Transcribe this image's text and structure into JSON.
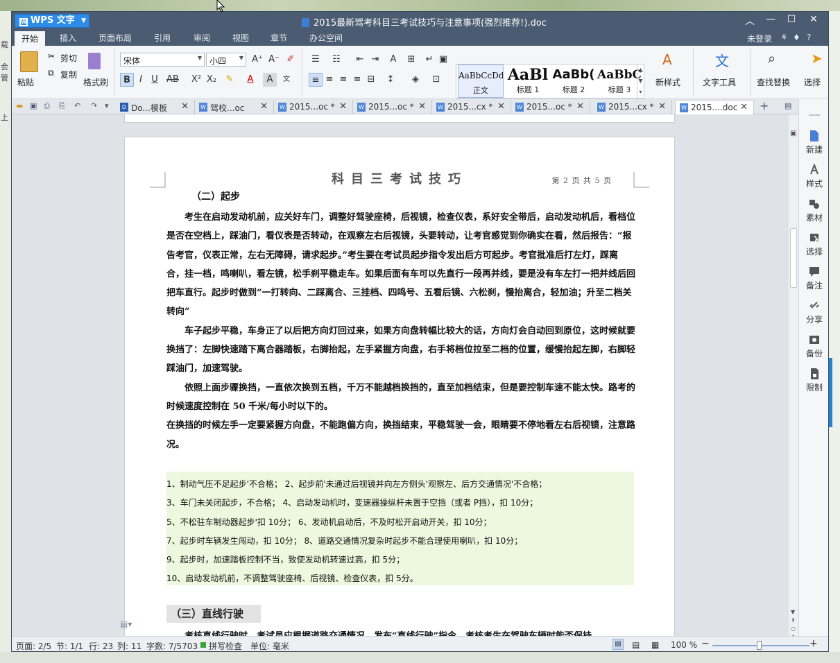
{
  "window": {
    "app_name": "WPS 文字",
    "doc_title": "2015最新驾考科目三考试技巧与注意事项(强烈推荐!).doc",
    "controls": [
      "︿",
      "—",
      "☐",
      "✕"
    ]
  },
  "menu": {
    "tabs": [
      "开始",
      "插入",
      "页面布局",
      "引用",
      "审阅",
      "视图",
      "章节",
      "办公空间"
    ],
    "login": "未登录",
    "help": "?"
  },
  "ribbon": {
    "paste": "粘贴",
    "cut": "剪切",
    "copy": "复制",
    "format_painter": "格式刷",
    "font_name": "宋体",
    "font_size": "小四",
    "styles": [
      {
        "sample": "AaBbCcDd",
        "label": "正文"
      },
      {
        "sample": "AaBl",
        "label": "标题 1"
      },
      {
        "sample": "AaBb(",
        "label": "标题 2"
      },
      {
        "sample": "AaBbC",
        "label": "标题 3"
      }
    ],
    "new_style": "新样式",
    "text_tools": "文字工具",
    "find_replace": "查找替换",
    "select": "选择"
  },
  "tabs": [
    {
      "label": "Do...模板"
    },
    {
      "label": "驾校...oc"
    },
    {
      "label": "2015...oc *"
    },
    {
      "label": "2015...oc *"
    },
    {
      "label": "2015...cx *"
    },
    {
      "label": "2015...oc *"
    },
    {
      "label": "2015...cx *"
    },
    {
      "label": "2015....doc"
    }
  ],
  "page": {
    "header_title": "科目三考试技巧",
    "header_page": "第 2 页 共 5 页",
    "subheading": "（二）起步",
    "paragraphs": [
      "考生在启动发动机前，应关好车门，调整好驾驶座椅，后视镜，检查仪表，系好安全带后，启动发动机后，看档位是否在空档上，踩油门，看仪表是否转动，在观察左右后视镜，头要转动，让考官感觉到你确实在看，然后报告：“报告考官，仪表正常，左右无障碍，请求起步。”考生要在考试员起步指令发出后方可起步。考官批准后打左灯，踩离合，挂一档，鸣喇叭，看左镜，松手刹平稳走车。如果后面有车可以先直行一段再并线，要是没有车左打一把并线后回把车直行。起步时做到“一打转向、二踩离合、三挂档、四鸣号、五看后镜、六松刹，慢抬离合，轻加油；升至二档关转向”",
      "车子起步平稳，车身正了以后把方向灯回过来，如果方向盘转幅比较大的话，方向灯会自动回到原位，这时候就要换挡了：左脚快速踏下离合器踏板，右脚抬起，左手紧握方向盘，右手将档位拉至二档的位置，缓慢抬起左脚，右脚轻踩油门，加速驾驶。",
      "依照上面步骤换挡，一直依次换到五档，千万不能越档换挡的，直至加档结束，但是要控制车速不能太快。路考的时候速度控制在 50 千米/每小时以下的。",
      "在换挡的时候左手一定要紧握方向盘，不能跑偏方向，换挡结束，平稳驾驶一会，眼睛要不停地看左右后视镜，注意路况。"
    ],
    "errors": [
      "1、制动气压不足起步'不合格；          2、起步前'未通过后视镜并向左方侧头'观察左、后方交通情况'不合格；",
      "3、车门未关闭起步，不合格；          4、启动发动机时，变速器操纵杆未置于空挡（或者 P挡），扣 10分；",
      "5、不松驻车制动器起步'扣 10分；    6、发动机启动后，不及时松开启动开关，扣 10分；",
      "7、起步时车辆发生闯动，扣 10分；  8、道路交通情况复杂时起步不能合理使用喇叭，扣 10分；",
      "9、起步时，加速踏板控制不当，致使发动机转速过高，扣 5分；",
      "10、启动发动机前，不调整驾驶座椅、后视镜、检查仪表，扣 5分。"
    ],
    "section3": "（三）直线行驶",
    "section3_text": "考核直线行驶时，考试员应根据道路交通情况，发布“直线行驶”指令，考核考生在驾驶车辆时能否保持"
  },
  "sidebar": [
    "新建",
    "样式",
    "素材",
    "选择",
    "备注",
    "分享",
    "备份",
    "限制"
  ],
  "status": {
    "page": "页面: 2/5",
    "section": "节: 1/1",
    "row": "行: 23",
    "col": "列: 11",
    "words": "字数: 7/5703",
    "spell": "拼写检查",
    "unit": "单位: 毫米",
    "zoom": "100 %"
  },
  "desktop_left": [
    "载",
    "会管",
    "上"
  ]
}
